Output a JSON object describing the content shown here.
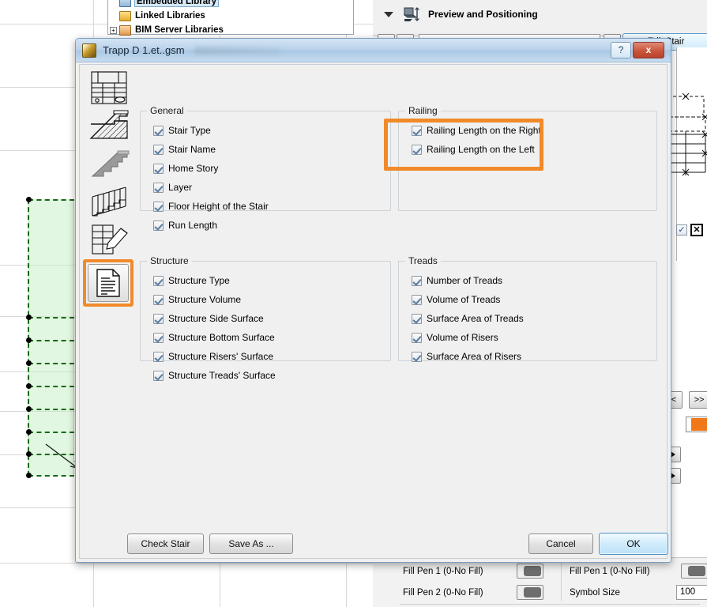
{
  "background": {
    "library_tree": {
      "items": [
        {
          "label": "Embedded Library",
          "icon": "bank-icon",
          "selected": true
        },
        {
          "label": "Linked Libraries",
          "icon": "folder-icon",
          "selected": false
        },
        {
          "label": "BIM Server Libraries",
          "icon": "server-icon",
          "selected": false
        }
      ]
    },
    "preview_positioning": {
      "title": "Preview and Positioning",
      "icon": "preview-positioning-icon",
      "collapse_icon": "triangle-down-icon",
      "prev_label": "<<",
      "next_label": ">>",
      "combo_value": "",
      "edit_button": "Edit Stair"
    },
    "right_nav": {
      "back_label": "<",
      "forward_label": ">>"
    },
    "bottom_settings": {
      "rows": [
        {
          "label": "Fill Pen 1 (0-No Fill)"
        },
        {
          "label": "Fill Pen 2 (0-No Fill)"
        }
      ],
      "right_rows": [
        {
          "label": "Fill Pen 1 (0-No Fill)",
          "value": ""
        },
        {
          "label": "Symbol Size",
          "value": "100"
        }
      ]
    }
  },
  "dialog": {
    "title": "Trapp D 1.et..gsm",
    "app_icon": "archicad-object-icon",
    "help_label": "?",
    "close_label": "x",
    "rail": {
      "items": [
        {
          "name": "stair-plan-icon",
          "selected": false
        },
        {
          "name": "stair-section-icon",
          "selected": false
        },
        {
          "name": "stair-3d-icon",
          "selected": false
        },
        {
          "name": "railing-icon",
          "selected": false
        },
        {
          "name": "stair-annotation-icon",
          "selected": false
        },
        {
          "name": "listing-document-icon",
          "selected": true
        }
      ]
    },
    "groups": [
      {
        "title": "General",
        "items": [
          {
            "label": "Stair Type",
            "checked": true
          },
          {
            "label": "Stair Name",
            "checked": true
          },
          {
            "label": "Home Story",
            "checked": true
          },
          {
            "label": "Layer",
            "checked": true
          },
          {
            "label": "Floor Height of the Stair",
            "checked": true
          },
          {
            "label": "Run Length",
            "checked": true
          }
        ]
      },
      {
        "title": "Railing",
        "items": [
          {
            "label": "Railing Length on the Right",
            "checked": true
          },
          {
            "label": "Railing Length on the Left",
            "checked": true
          }
        ]
      },
      {
        "title": "Structure",
        "items": [
          {
            "label": "Structure Type",
            "checked": true
          },
          {
            "label": "Structure Volume",
            "checked": true
          },
          {
            "label": "Structure Side Surface",
            "checked": true
          },
          {
            "label": "Structure Bottom Surface",
            "checked": true
          },
          {
            "label": "Structure Risers' Surface",
            "checked": true
          },
          {
            "label": "Structure Treads' Surface",
            "checked": true
          }
        ]
      },
      {
        "title": "Treads",
        "items": [
          {
            "label": "Number of Treads",
            "checked": true
          },
          {
            "label": "Volume of Treads",
            "checked": true
          },
          {
            "label": "Surface Area of Treads",
            "checked": true
          },
          {
            "label": "Volume of Risers",
            "checked": true
          },
          {
            "label": "Surface Area of Risers",
            "checked": true
          }
        ]
      }
    ],
    "buttons": {
      "check_stair": "Check Stair",
      "save_as": "Save As ...",
      "cancel": "Cancel",
      "ok": "OK"
    }
  },
  "colors": {
    "highlight": "#f08a2a",
    "selection_green": "#186818",
    "accent_blue": "#4f93c8",
    "swatch_orange": "#f07818"
  }
}
